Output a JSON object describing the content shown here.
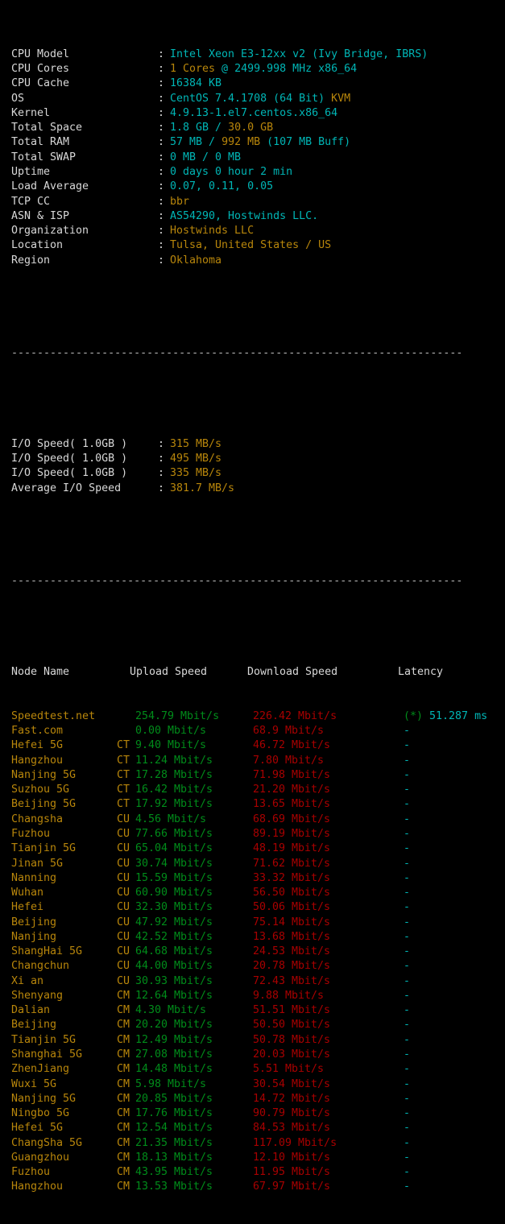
{
  "terminal": {
    "separator": "----------------------------------------------------------------------",
    "colon": ":"
  },
  "system_info": [
    {
      "label": "CPU Model",
      "value": "Intel Xeon E3-12xx v2 (Ivy Bridge, IBRS)",
      "color": "cyan"
    },
    {
      "label": "CPU Cores",
      "value_parts": [
        {
          "text": "1 Cores",
          "color": "yellow"
        },
        {
          "text": " @ 2499.998 MHz x86_64",
          "color": "cyan"
        }
      ]
    },
    {
      "label": "CPU Cache",
      "value": "16384 KB",
      "color": "cyan"
    },
    {
      "label": "OS",
      "value_parts": [
        {
          "text": "CentOS 7.4.1708 (64 Bit) ",
          "color": "cyan"
        },
        {
          "text": "KVM",
          "color": "yellow"
        }
      ]
    },
    {
      "label": "Kernel",
      "value": "4.9.13-1.el7.centos.x86_64",
      "color": "cyan"
    },
    {
      "label": "Total Space",
      "value_parts": [
        {
          "text": "1.8 GB ",
          "color": "cyan"
        },
        {
          "text": "/ ",
          "color": "cyan"
        },
        {
          "text": "30.0 GB",
          "color": "yellow"
        }
      ]
    },
    {
      "label": "Total RAM",
      "value_parts": [
        {
          "text": "57 MB ",
          "color": "cyan"
        },
        {
          "text": "/ ",
          "color": "cyan"
        },
        {
          "text": "992 MB",
          "color": "yellow"
        },
        {
          "text": " (107 MB Buff)",
          "color": "cyan"
        }
      ]
    },
    {
      "label": "Total SWAP",
      "value": "0 MB / 0 MB",
      "color": "cyan"
    },
    {
      "label": "Uptime",
      "value": "0 days 0 hour 2 min",
      "color": "cyan"
    },
    {
      "label": "Load Average",
      "value": "0.07, 0.11, 0.05",
      "color": "cyan"
    },
    {
      "label": "TCP CC",
      "value": "bbr",
      "color": "yellow"
    },
    {
      "label": "ASN & ISP",
      "value": "AS54290, Hostwinds LLC.",
      "color": "cyan"
    },
    {
      "label": "Organization",
      "value": "Hostwinds LLC",
      "color": "yellow"
    },
    {
      "label": "Location",
      "value": "Tulsa, United States / US",
      "color": "yellow"
    },
    {
      "label": "Region",
      "value": "Oklahoma",
      "color": "yellow"
    }
  ],
  "io_tests": [
    {
      "label": "I/O Speed( 1.0GB )",
      "value": "315 MB/s",
      "color": "yellow"
    },
    {
      "label": "I/O Speed( 1.0GB )",
      "value": "495 MB/s",
      "color": "yellow"
    },
    {
      "label": "I/O Speed( 1.0GB )",
      "value": "335 MB/s",
      "color": "yellow"
    },
    {
      "label": "Average I/O Speed",
      "value": "381.7 MB/s",
      "color": "yellow"
    }
  ],
  "node_table": {
    "headers": {
      "node_name": "Node Name",
      "upload": "Upload Speed",
      "download": "Download Speed",
      "latency": "Latency"
    },
    "rows": [
      {
        "name": "Speedtest.net",
        "tag": "",
        "upload": "254.79 Mbit/s",
        "download": "226.42 Mbit/s",
        "latency_star": "(*)",
        "latency": "51.287",
        "latency_unit": "ms"
      },
      {
        "name": "Fast.com",
        "tag": "",
        "upload": "0.00 Mbit/s",
        "download": "68.9 Mbit/s",
        "latency": "-"
      },
      {
        "name": "Hefei 5G",
        "tag": "CT",
        "upload": "9.40 Mbit/s",
        "download": "46.72 Mbit/s",
        "latency": "-"
      },
      {
        "name": "Hangzhou",
        "tag": "CT",
        "upload": "11.24 Mbit/s",
        "download": "7.80 Mbit/s",
        "latency": "-"
      },
      {
        "name": "Nanjing 5G",
        "tag": "CT",
        "upload": "17.28 Mbit/s",
        "download": "71.98 Mbit/s",
        "latency": "-"
      },
      {
        "name": "Suzhou 5G",
        "tag": "CT",
        "upload": "16.42 Mbit/s",
        "download": "21.20 Mbit/s",
        "latency": "-"
      },
      {
        "name": "Beijing 5G",
        "tag": "CT",
        "upload": "17.92 Mbit/s",
        "download": "13.65 Mbit/s",
        "latency": "-"
      },
      {
        "name": "Changsha",
        "tag": "CU",
        "upload": "4.56 Mbit/s",
        "download": "68.69 Mbit/s",
        "latency": "-"
      },
      {
        "name": "Fuzhou",
        "tag": "CU",
        "upload": "77.66 Mbit/s",
        "download": "89.19 Mbit/s",
        "latency": "-"
      },
      {
        "name": "Tianjin 5G",
        "tag": "CU",
        "upload": "65.04 Mbit/s",
        "download": "48.19 Mbit/s",
        "latency": "-"
      },
      {
        "name": "Jinan 5G",
        "tag": "CU",
        "upload": "30.74 Mbit/s",
        "download": "71.62 Mbit/s",
        "latency": "-"
      },
      {
        "name": "Nanning",
        "tag": "CU",
        "upload": "15.59 Mbit/s",
        "download": "33.32 Mbit/s",
        "latency": "-"
      },
      {
        "name": "Wuhan",
        "tag": "CU",
        "upload": "60.90 Mbit/s",
        "download": "56.50 Mbit/s",
        "latency": "-"
      },
      {
        "name": "Hefei",
        "tag": "CU",
        "upload": "32.30 Mbit/s",
        "download": "50.06 Mbit/s",
        "latency": "-"
      },
      {
        "name": "Beijing",
        "tag": "CU",
        "upload": "47.92 Mbit/s",
        "download": "75.14 Mbit/s",
        "latency": "-"
      },
      {
        "name": "Nanjing",
        "tag": "CU",
        "upload": "42.52 Mbit/s",
        "download": "13.68 Mbit/s",
        "latency": "-"
      },
      {
        "name": "ShangHai 5G",
        "tag": "CU",
        "upload": "64.68 Mbit/s",
        "download": "24.53 Mbit/s",
        "latency": "-"
      },
      {
        "name": "Changchun",
        "tag": "CU",
        "upload": "44.00 Mbit/s",
        "download": "20.78 Mbit/s",
        "latency": "-"
      },
      {
        "name": "Xi an",
        "tag": "CU",
        "upload": "30.93 Mbit/s",
        "download": "72.43 Mbit/s",
        "latency": "-"
      },
      {
        "name": "Shenyang",
        "tag": "CM",
        "upload": "12.64 Mbit/s",
        "download": "9.88 Mbit/s",
        "latency": "-"
      },
      {
        "name": "Dalian",
        "tag": "CM",
        "upload": "4.30 Mbit/s",
        "download": "51.51 Mbit/s",
        "latency": "-"
      },
      {
        "name": "Beijing",
        "tag": "CM",
        "upload": "20.20 Mbit/s",
        "download": "50.50 Mbit/s",
        "latency": "-"
      },
      {
        "name": "Tianjin 5G",
        "tag": "CM",
        "upload": "12.49 Mbit/s",
        "download": "50.78 Mbit/s",
        "latency": "-"
      },
      {
        "name": "Shanghai 5G",
        "tag": "CM",
        "upload": "27.08 Mbit/s",
        "download": "20.03 Mbit/s",
        "latency": "-"
      },
      {
        "name": "ZhenJiang",
        "tag": "CM",
        "upload": "14.48 Mbit/s",
        "download": "5.51 Mbit/s",
        "latency": "-"
      },
      {
        "name": "Wuxi 5G",
        "tag": "CM",
        "upload": "5.98 Mbit/s",
        "download": "30.54 Mbit/s",
        "latency": "-"
      },
      {
        "name": "Nanjing 5G",
        "tag": "CM",
        "upload": "20.85 Mbit/s",
        "download": "14.72 Mbit/s",
        "latency": "-"
      },
      {
        "name": "Ningbo 5G",
        "tag": "CM",
        "upload": "17.76 Mbit/s",
        "download": "90.79 Mbit/s",
        "latency": "-"
      },
      {
        "name": "Hefei 5G",
        "tag": "CM",
        "upload": "12.54 Mbit/s",
        "download": "84.53 Mbit/s",
        "latency": "-"
      },
      {
        "name": "ChangSha 5G",
        "tag": "CM",
        "upload": "21.35 Mbit/s",
        "download": "117.09 Mbit/s",
        "latency": "-"
      },
      {
        "name": "Guangzhou",
        "tag": "CM",
        "upload": "18.13 Mbit/s",
        "download": "12.10 Mbit/s",
        "latency": "-"
      },
      {
        "name": "Fuzhou",
        "tag": "CM",
        "upload": "43.95 Mbit/s",
        "download": "11.95 Mbit/s",
        "latency": "-"
      },
      {
        "name": "Hangzhou",
        "tag": "CM",
        "upload": "13.53 Mbit/s",
        "download": "67.97 Mbit/s",
        "latency": "-"
      }
    ]
  },
  "colors": {
    "background": "#000000",
    "label": "#d8d8d8",
    "cyan": "#00b6b6",
    "yellow": "#b8860b",
    "green": "#008c1a",
    "red": "#a80000",
    "separator": "#b8b8b8"
  }
}
